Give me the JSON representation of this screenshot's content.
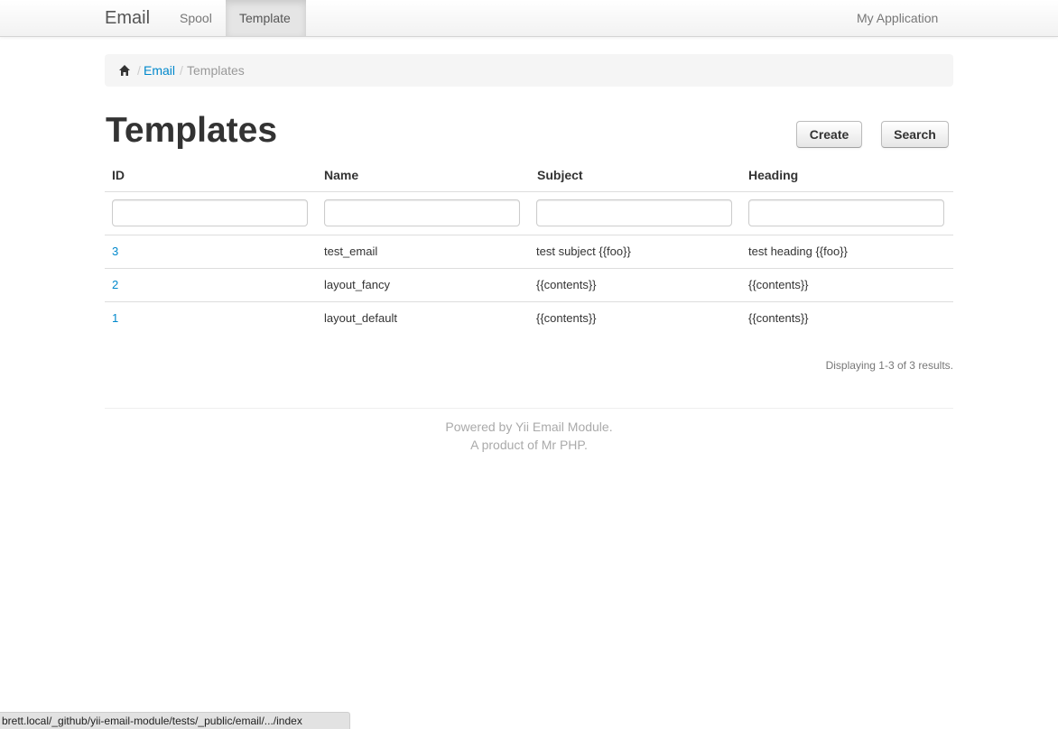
{
  "navbar": {
    "brand": "Email",
    "items": [
      {
        "label": "Spool",
        "active": false
      },
      {
        "label": "Template",
        "active": true
      }
    ],
    "right_label": "My Application"
  },
  "breadcrumb": {
    "home_icon": "home-icon",
    "separator": "/",
    "items": [
      "Email",
      "Templates"
    ]
  },
  "page": {
    "title": "Templates",
    "buttons": {
      "create": "Create",
      "search": "Search"
    }
  },
  "grid": {
    "columns": [
      "ID",
      "Name",
      "Subject",
      "Heading"
    ],
    "filters": [
      "",
      "",
      "",
      ""
    ],
    "rows": [
      {
        "id": "3",
        "name": "test_email",
        "subject": "test subject {{foo}}",
        "heading": "test heading {{foo}}"
      },
      {
        "id": "2",
        "name": "layout_fancy",
        "subject": "{{contents}}",
        "heading": "{{contents}}"
      },
      {
        "id": "1",
        "name": "layout_default",
        "subject": "{{contents}}",
        "heading": "{{contents}}"
      }
    ],
    "summary": "Displaying 1-3 of 3 results."
  },
  "footer": {
    "line1": "Powered by Yii Email Module.",
    "line2": "A product of Mr PHP."
  },
  "statusbar": {
    "url": "brett.local/_github/yii-email-module/tests/_public/email/.../index"
  },
  "colors": {
    "link": "#0088cc",
    "text": "#333333",
    "muted": "#999999"
  }
}
